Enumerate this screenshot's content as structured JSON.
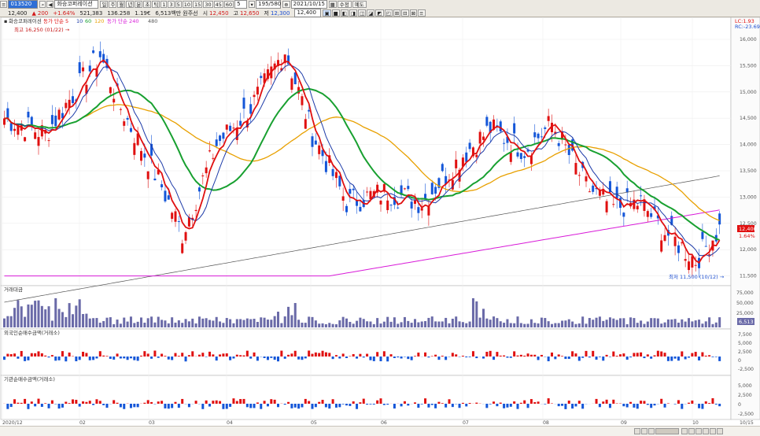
{
  "toolbar": {
    "code": "013520",
    "stock_name": "화승코퍼레이션",
    "price": "12,400",
    "change_arrow": "▲",
    "change": "200",
    "change_pct": "+1.64%",
    "volume": "521,383",
    "turnover": "136.258",
    "ratio": "1.19€",
    "market_cap": "6,513백만",
    "market_label": "원주선",
    "open_label": "시",
    "open": "12,450",
    "high_label": "고",
    "high": "12,650",
    "low_label": "저",
    "low": "12,300",
    "last_value": "12,400",
    "periods": [
      "일",
      "주",
      "월",
      "년",
      "분",
      "초",
      "틱"
    ],
    "active_period": "일",
    "minutes": [
      "1",
      "3",
      "5",
      "10",
      "15",
      "30",
      "45",
      "60"
    ],
    "count": "5",
    "display_count": "195/580",
    "date": "2021/10/15",
    "adj_label": "수정",
    "more_label": "예도",
    "extra_buttons": [
      "▣",
      "■",
      "◧",
      "◨",
      "◫",
      "◪",
      "◩",
      "◰",
      "⊞",
      "⊟",
      "⊠",
      "≡"
    ]
  },
  "price_panel": {
    "legend_name": "화승코퍼레이션",
    "legend_items": [
      {
        "text": "동가 단순 5",
        "color": "#e01010"
      },
      {
        "text": "10",
        "color": "#1c3aa8"
      },
      {
        "text": "60",
        "color": "#18a030"
      },
      {
        "text": "120",
        "color": "#e8a000"
      },
      {
        "text": "동가 단순 240",
        "color": "#d81bd8"
      },
      {
        "text": "480",
        "color": "#555555"
      }
    ],
    "high_note": "최고 16,250 (01/22) →",
    "low_note": "최저 11,500 (10/12) →",
    "right_indicators": [
      "LC:1.93",
      "RC:-23.69"
    ],
    "y_ticks": [
      "16,000",
      "15,500",
      "15,000",
      "14,500",
      "14,000",
      "13,500",
      "13,000",
      "12,500",
      "12,000",
      "11,500"
    ],
    "price_tag": "12,400",
    "ref_tag": "1.64%"
  },
  "volume_panel": {
    "title": "거래대금",
    "y_ticks": [
      "75,000",
      "50,000",
      "25,000"
    ],
    "tag": "6,513"
  },
  "foreign_panel": {
    "title": "외국인순매수금액(거래소)",
    "y_ticks": [
      "7,500",
      "5,000",
      "2,500",
      "0",
      "-2,500"
    ]
  },
  "inst_panel": {
    "title": "기관순매수금액(거래소)",
    "y_ticks": [
      "5,000",
      "2,500",
      "0",
      "-2,500"
    ]
  },
  "x_axis": [
    "2020/12",
    "02",
    "03",
    "04",
    "05",
    "06",
    "07",
    "08",
    "09",
    "10",
    "10/15"
  ],
  "colors": {
    "up": "#e01010",
    "down": "#1456d8",
    "volume": "#6a6aa8",
    "ma5": "#e01010",
    "ma10": "#1c3aa8",
    "ma60": "#18a030",
    "ma120": "#e8a000",
    "ma240": "#d81bd8",
    "ma480": "#555555"
  }
}
